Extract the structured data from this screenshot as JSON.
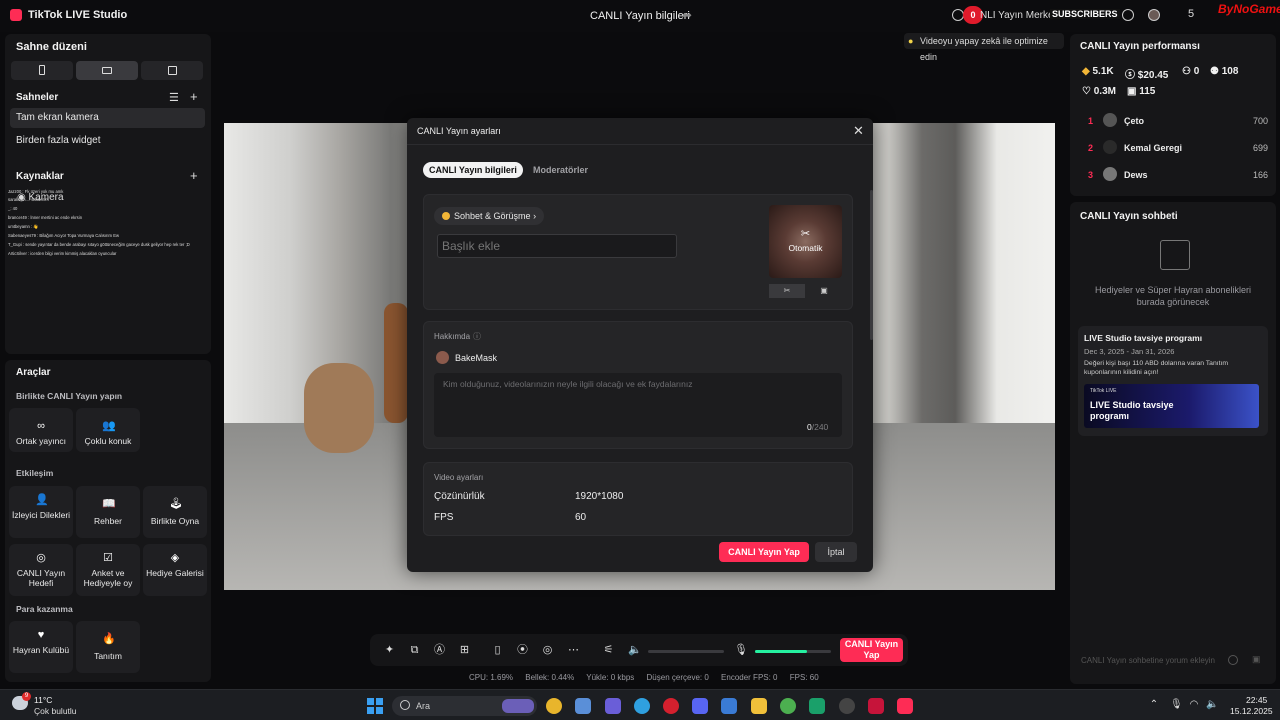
{
  "titlebar": {
    "app_title": "TikTok LIVE Studio",
    "window_title": "CANLI Yayın bilgileri"
  },
  "overlay": {
    "badge": "0",
    "center_text": "NLI Yayın Merkez",
    "subs": "SUBSCRIBERS",
    "count": "5",
    "brand": "ByNoGame"
  },
  "tip": "Videoyu yapay zekâ ile optimize edin",
  "left": {
    "layout_title": "Sahne düzeni",
    "scenes_title": "Sahneler",
    "scenes": [
      "Tam ekran kamera",
      "Birden fazla widget"
    ],
    "sources_title": "Kaynaklar",
    "camera_label": "Kamera",
    "chat_lines": [
      "Jazz00 : Fk üzeri yok mu amk",
      "sarakırım...: sarakırım",
      "_: 40",
      "brancer49 : İnner mertini ac ende ekrsin",
      "umtbeyamn : 👋",
      "Sabenaeyes79 : Bilağım Acıyor Topa Vurmaya Calısırım Ew",
      "T_Gupi : sende yayıntar da bende arabayı sıtayo göttüneceğim gaceye dusk geliyor hep rek ter ;D",
      "ArticSilver : icerden bilgi verim kimmiş alacaklan oyuncular"
    ],
    "tools_title": "Araçlar",
    "group1": "Birlikte CANLI Yayın yapın",
    "tools1": [
      "Ortak yayıncı",
      "Çoklu konuk"
    ],
    "group2": "Etkileşim",
    "tools2": [
      "İzleyici Dilekleri",
      "Rehber",
      "Birlikte Oyna",
      "CANLI Yayın Hedefi",
      "Anket ve Hediyeyle oy",
      "Hediye Galerisi"
    ],
    "group3": "Para kazanma",
    "tools3": [
      "Hayran Kulübü",
      "Tanıtım"
    ]
  },
  "modal": {
    "title": "CANLI Yayın ayarları",
    "tabs": [
      "CANLI Yayın bilgileri",
      "Moderatörler"
    ],
    "category": "Sohbet & Görüşme",
    "title_placeholder": "Başlık ekle",
    "thumb_label": "Otomatik",
    "about_label": "Hakkımda",
    "username": "BakeMask",
    "about_placeholder": "Kim olduğunuz, videolarınızın neyle ilgili olacağı ve ek faydalarınız",
    "about_count": "0",
    "about_max": "/240",
    "video_label": "Video ayarları",
    "rows": [
      {
        "label": "Çözünürlük",
        "value": "1920*1080"
      },
      {
        "label": "FPS",
        "value": "60"
      }
    ],
    "go_live": "CANLI Yayın Yap",
    "cancel": "İptal"
  },
  "perf": {
    "title": "CANLI Yayın performansı",
    "stats": [
      "5.1K",
      "$20.45",
      "0",
      "108",
      "0.3M",
      "115"
    ],
    "ranking": [
      {
        "rank": "1",
        "name": "Çeto",
        "value": "700"
      },
      {
        "rank": "2",
        "name": "Kemal Geregi",
        "value": "699"
      },
      {
        "rank": "3",
        "name": "Dews",
        "value": "166"
      }
    ]
  },
  "chat": {
    "title": "CANLI Yayın sohbeti",
    "empty": "Hediyeler ve Süper Hayran abonelikleri burada görünecek",
    "promo_title": "LIVE Studio tavsiye programı",
    "promo_dates": "Dec 3, 2025 - Jan 31, 2026",
    "promo_desc": "Değeri kişi başı 110 ABD dolarına varan Tanıtım kuponlarının kilidini açın!",
    "promo_brand": "TikTok LIVE",
    "promo_banner": "LIVE Studio tavsiye programı",
    "input_placeholder": "CANLI Yayın sohbetine yorum ekleyin"
  },
  "controls": {
    "live": "CANLI Yayın Yap",
    "mic_level": 0.68
  },
  "stats": [
    "CPU:  1.69%",
    "Bellek:  0.44%",
    "Yükle:  0 kbps",
    "Düşen çerçeve:  0",
    "Encoder FPS:  0",
    "FPS:  60"
  ],
  "taskbar": {
    "temp": "11°C",
    "weather": "Çok bulutlu",
    "weather_badge": "9",
    "search": "Ara",
    "time": "22:45",
    "date": "15.12.2025"
  },
  "colors": {
    "accent": "#fe2c55",
    "mic": "#25f0a0"
  }
}
